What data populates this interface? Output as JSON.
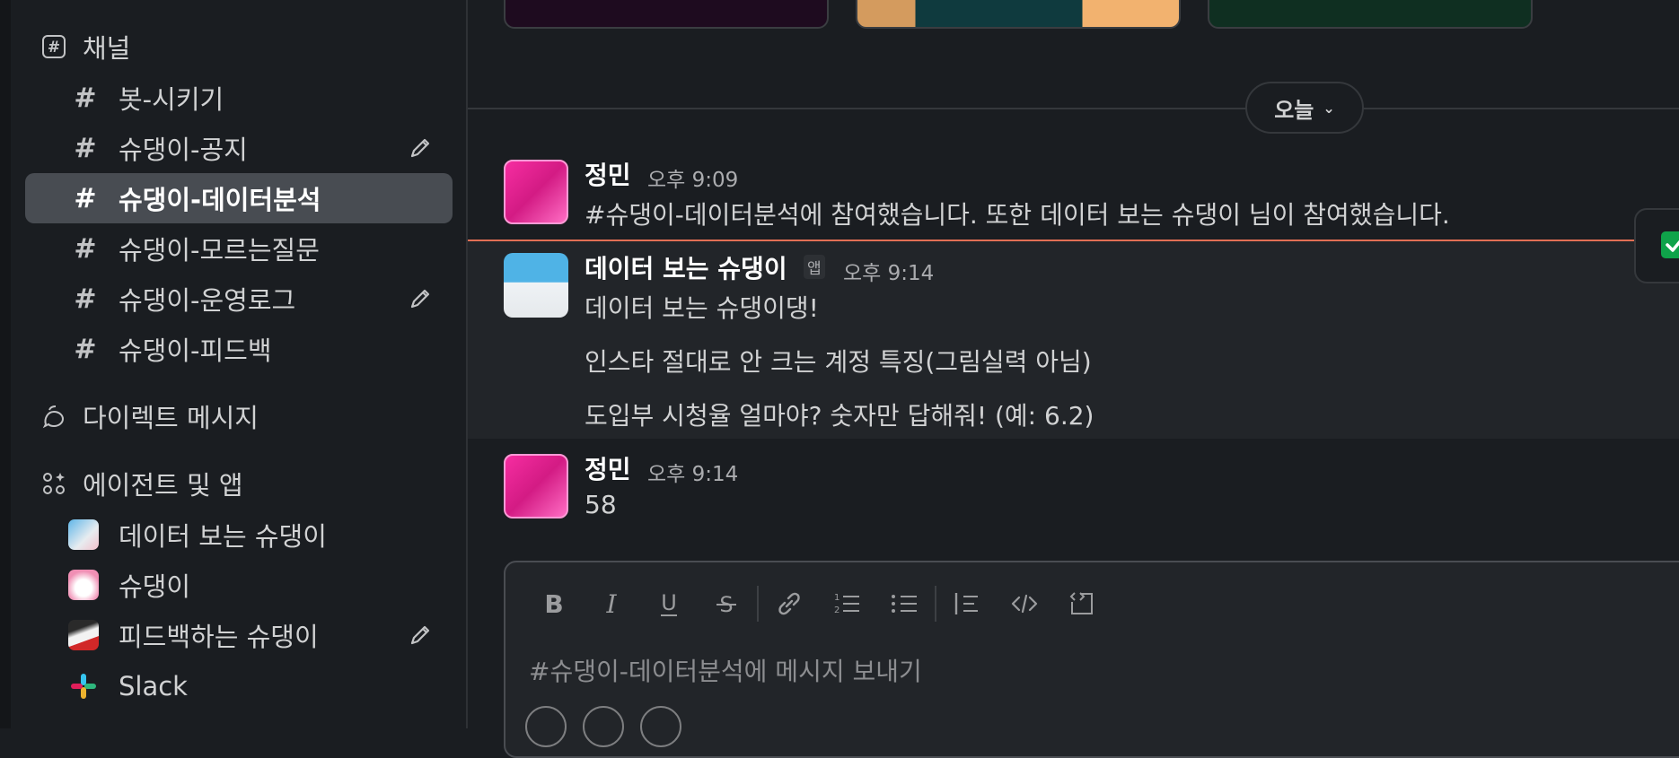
{
  "sidebar": {
    "channels_header": "채널",
    "channels": [
      {
        "name": "봇-시키기"
      },
      {
        "name": "슈댕이-공지"
      },
      {
        "name": "슈댕이-데이터분석"
      },
      {
        "name": "슈댕이-모르는질문"
      },
      {
        "name": "슈댕이-운영로그"
      },
      {
        "name": "슈댕이-피드백"
      }
    ],
    "dm_header": "다이렉트 메시지",
    "apps_header": "에이전트 및 앱",
    "apps": [
      {
        "name": "데이터 보는 슈댕이"
      },
      {
        "name": "슈댕이"
      },
      {
        "name": "피드백하는 슈댕이"
      },
      {
        "name": "Slack"
      }
    ]
  },
  "main": {
    "date_divider": "오늘",
    "messages": [
      {
        "user": "정민",
        "time": "오후 9:09",
        "lines": [
          "#슈댕이-데이터분석에 참여했습니다. 또한 데이터 보는 슈댕이 님이 참여했습니다."
        ]
      },
      {
        "user": "데이터 보는 슈댕이",
        "badge": "앱",
        "time": "오후 9:14",
        "lines": [
          "데이터 보는 슈댕이댕!",
          "인스타 절대로 안 크는 계정 특징(그림실력 아님)",
          "도입부 시청율 얼마야? 숫자만 답해줘! (예: 6.2)"
        ]
      },
      {
        "user": "정민",
        "time": "오후 9:14",
        "lines": [
          "58"
        ]
      }
    ],
    "composer_placeholder": "#슈댕이-데이터분석에 메시지 보내기"
  },
  "colors": {
    "accent_active": "#484c52",
    "new_line": "#e26f54",
    "background": "#1a1d21"
  }
}
